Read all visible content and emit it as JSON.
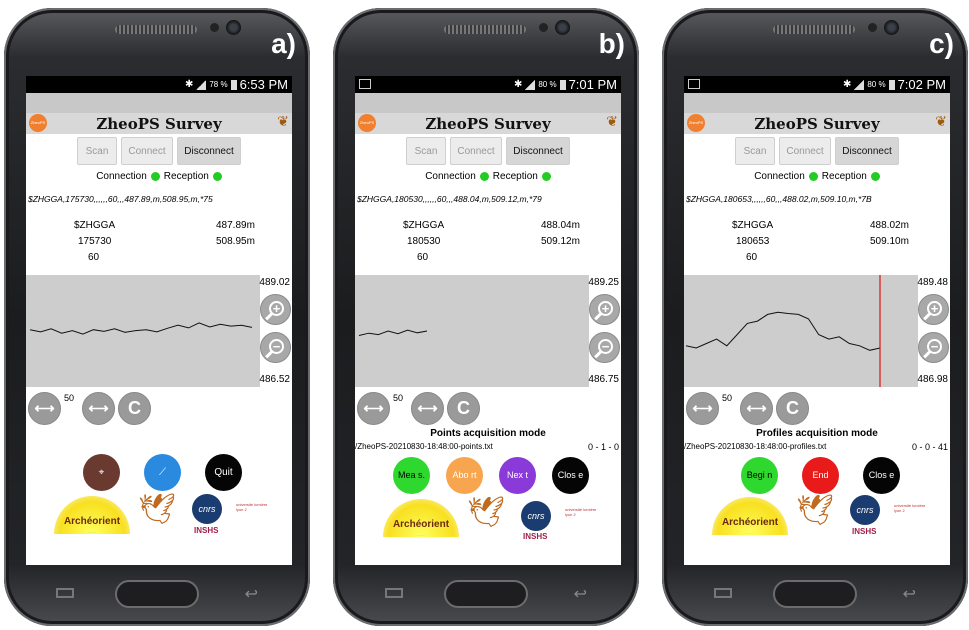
{
  "app": {
    "title": "ZheoPS Survey",
    "buttons": {
      "scan": "Scan",
      "connect": "Connect",
      "disconnect": "Disconnect"
    },
    "connection_label": "Connection",
    "reception_label": "Reception",
    "status_color": "#22cc22",
    "zoom_label": "C"
  },
  "phones": {
    "a": {
      "label": "a)",
      "status": {
        "battery": "78 %",
        "time": "6:53 PM"
      },
      "nmea": "$ZHGGA,175730,,,,,,60,,,487.89,m,508.95,m,*75",
      "values": {
        "id": "$ZHGGA",
        "time": "175730",
        "sats": "60",
        "alt1": "487.89m",
        "alt2": "508.95m"
      },
      "plot": {
        "ymax": "489.02",
        "ymin": "486.52"
      },
      "range": "50",
      "main_actions": {
        "quit": "Quit"
      },
      "chart_data": {
        "type": "line",
        "ylim": [
          486.52,
          489.02
        ],
        "series": [
          {
            "values": [
              487.8,
              487.75,
              487.82,
              487.72,
              487.78,
              487.7,
              487.8,
              487.76,
              487.82,
              487.74,
              487.78,
              487.8,
              487.75,
              487.83,
              487.9,
              487.84,
              487.95,
              487.86,
              487.92,
              487.88,
              487.9,
              487.85
            ]
          }
        ]
      }
    },
    "b": {
      "label": "b)",
      "status": {
        "battery": "80 %",
        "time": "7:01 PM"
      },
      "nmea": "$ZHGGA,180530,,,,,,60,,,488.04,m,509.12,m,*79",
      "values": {
        "id": "$ZHGGA",
        "time": "180530",
        "sats": "60",
        "alt1": "488.04m",
        "alt2": "509.12m"
      },
      "plot": {
        "ymax": "489.25",
        "ymin": "486.75"
      },
      "range": "50",
      "mode": "Points acquisition mode",
      "file": "/ZheoPS-20210830-18:48:00-points.txt",
      "counter": "0 - 1 - 0",
      "actions": {
        "a1": "Mea s.",
        "a2": "Abo rt",
        "a3": "Nex t",
        "a4": "Clos e"
      },
      "chart_data": {
        "type": "line",
        "ylim": [
          486.75,
          489.25
        ],
        "series": [
          {
            "values": [
              487.9,
              487.95,
              487.92,
              488.0,
              487.94,
              488.02,
              487.96,
              488.0
            ]
          }
        ]
      }
    },
    "c": {
      "label": "c)",
      "status": {
        "battery": "80 %",
        "time": "7:02 PM"
      },
      "nmea": "$ZHGGA,180653,,,,,,60,,,488.02,m,509.10,m,*7B",
      "values": {
        "id": "$ZHGGA",
        "time": "180653",
        "sats": "60",
        "alt1": "488.02m",
        "alt2": "509.10m"
      },
      "plot": {
        "ymax": "489.48",
        "ymin": "486.98"
      },
      "range": "50",
      "mode": "Profiles acquisition mode",
      "file": "/ZheoPS-20210830-18:48:00-profiles.txt",
      "counter": "0 - 0 - 41",
      "actions": {
        "a1": "Begi n",
        "a2": "End",
        "a3": "Clos e"
      },
      "chart_data": {
        "type": "line",
        "ylim": [
          486.98,
          489.48
        ],
        "series": [
          {
            "values": [
              487.9,
              487.85,
              487.95,
              488.05,
              487.9,
              488.15,
              488.4,
              488.45,
              488.6,
              488.65,
              488.62,
              488.6,
              488.5,
              488.15,
              488.05,
              488.1,
              487.95,
              487.9,
              487.8,
              487.85
            ]
          }
        ]
      }
    }
  }
}
